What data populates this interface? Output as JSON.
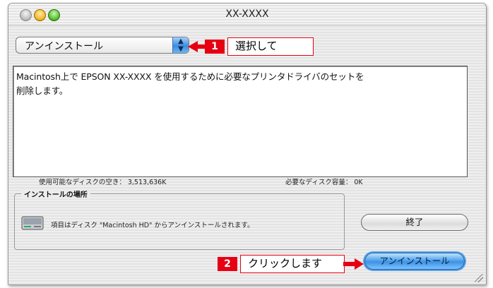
{
  "window": {
    "title": "XX-XXXX"
  },
  "popup": {
    "selected": "アンインストール"
  },
  "callouts": [
    {
      "number": "1",
      "text": "選択して"
    },
    {
      "number": "2",
      "text": "クリックします"
    }
  ],
  "description": {
    "line1": "Macintosh上で EPSON XX-XXXX を使用するために必要なプリンタドライバのセットを",
    "line2": "削除します。"
  },
  "disk": {
    "available": "使用可能なディスクの空き： 3,513,636K",
    "required": "必要なディスク容量： 0K"
  },
  "location": {
    "label": "インストールの場所",
    "message": "項目はディスク \"Macintosh HD\" からアンインストールされます。"
  },
  "buttons": {
    "quit": "終了",
    "uninstall": "アンインストール"
  },
  "colors": {
    "accent": "#3b93e6",
    "callout_red": "#e60012"
  },
  "icons": [
    "close-icon",
    "minimize-icon",
    "zoom-icon",
    "popup-arrow-icon",
    "hard-disk-icon",
    "callout-arrow-icon",
    "resize-grip-icon"
  ]
}
